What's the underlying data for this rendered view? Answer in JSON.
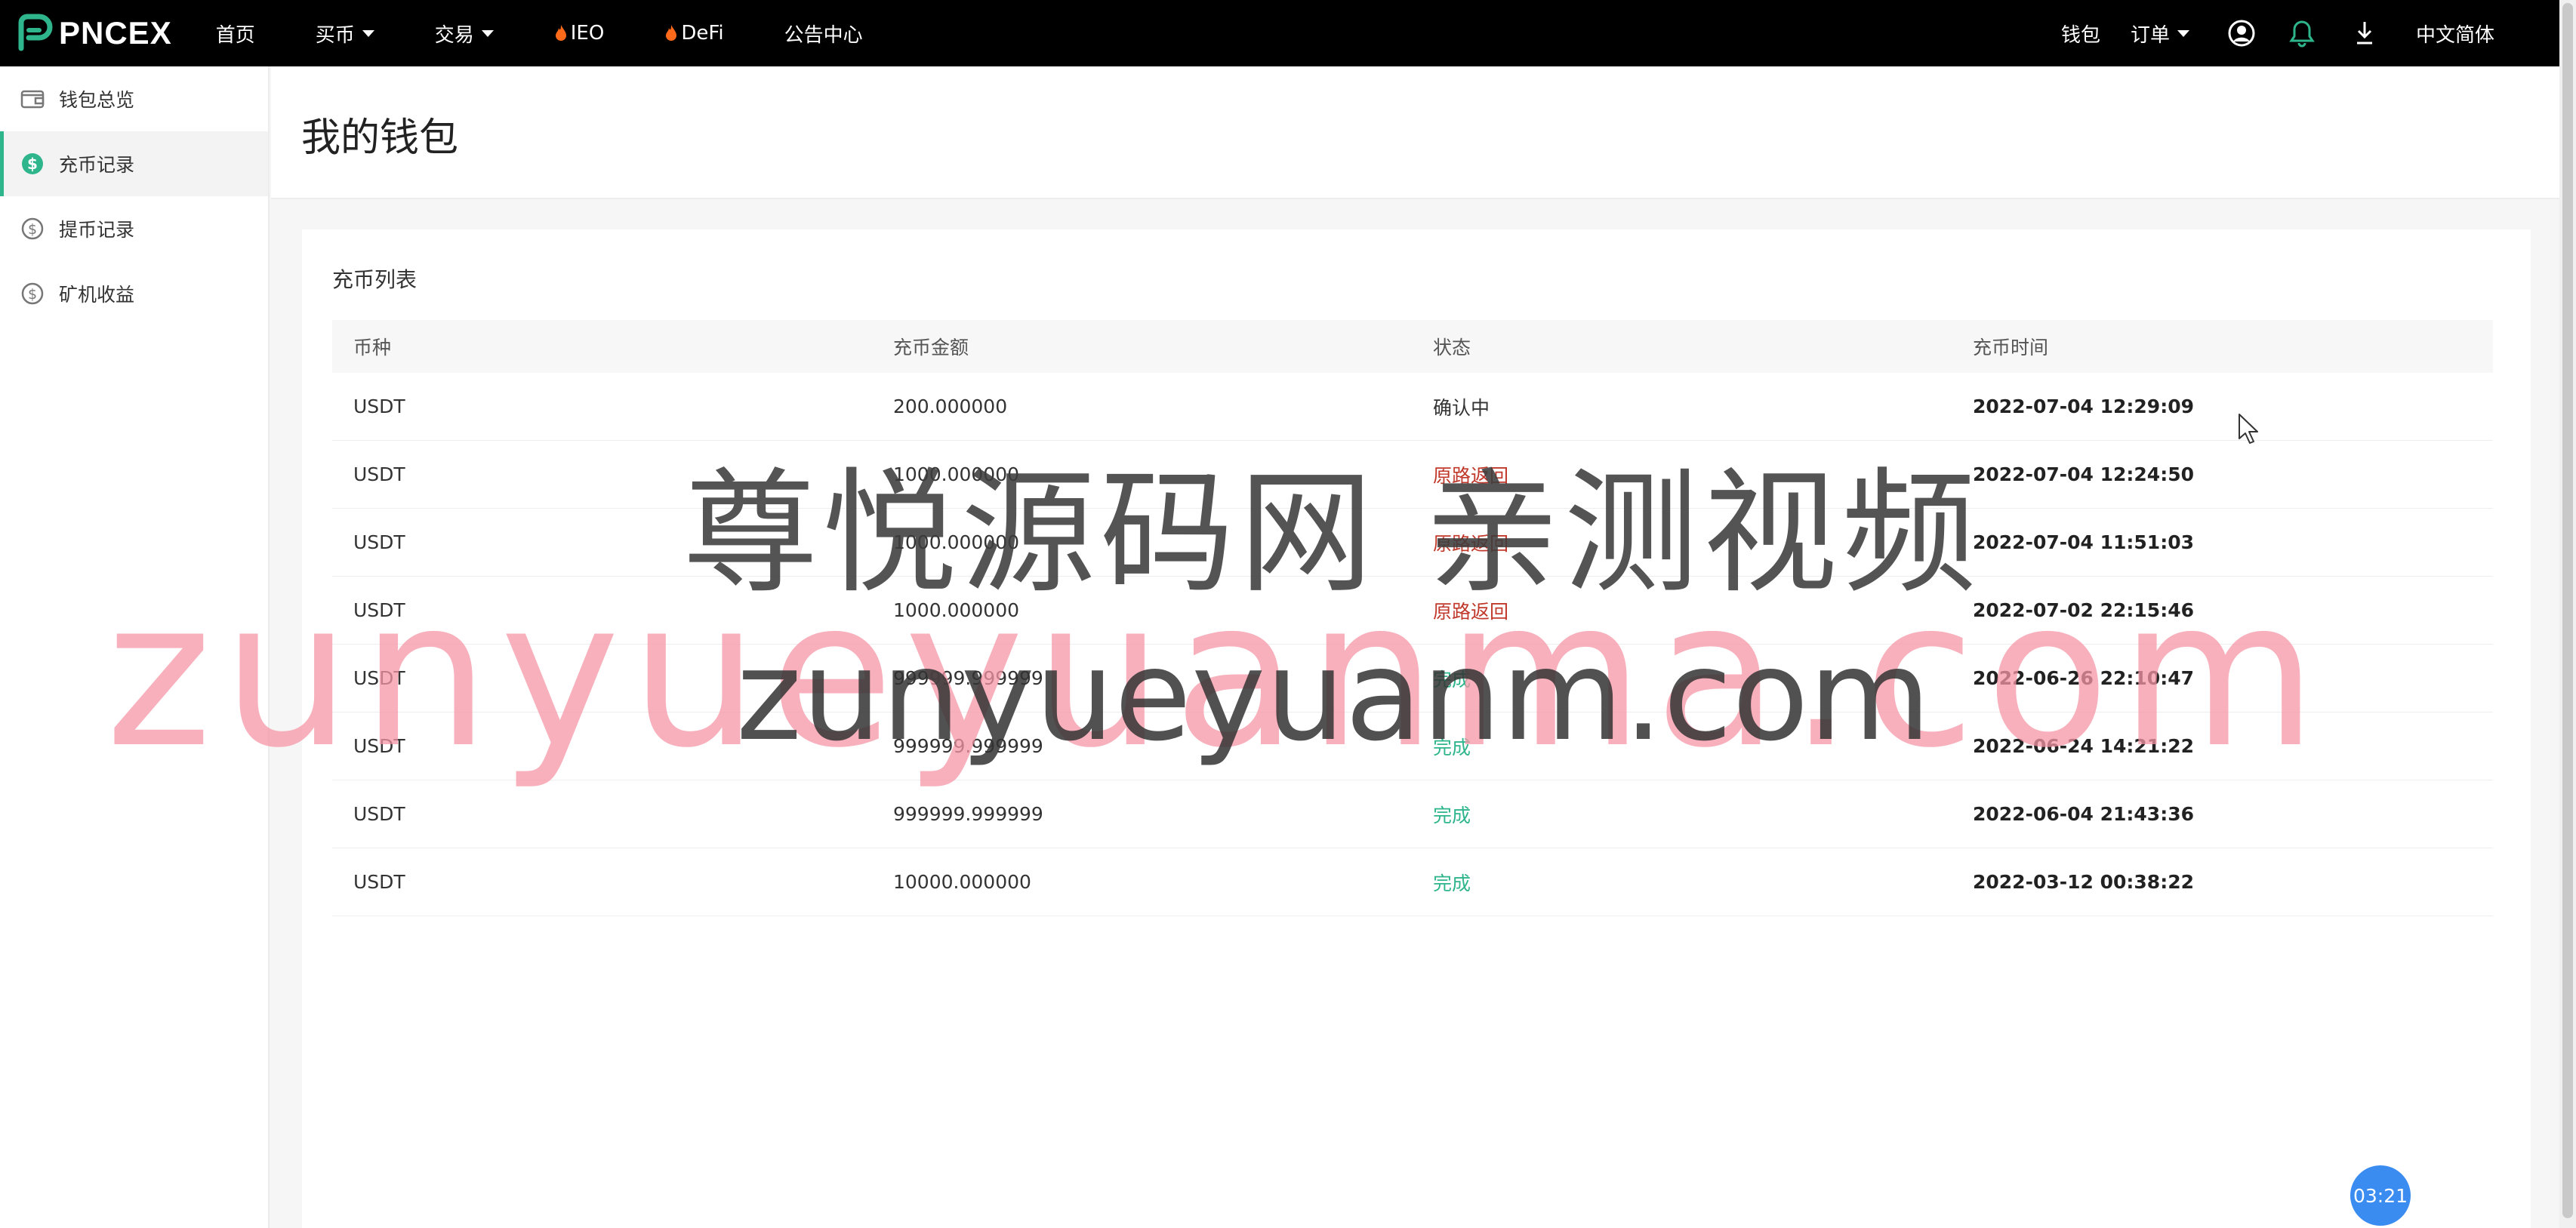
{
  "brand": {
    "name": "PNCEX",
    "accent": "#2eb58c"
  },
  "nav": {
    "home": "首页",
    "buy": "买币",
    "trade": "交易",
    "ieo": "IEO",
    "defi": "DeFi",
    "announcements": "公告中心",
    "wallet": "钱包",
    "orders": "订单",
    "language": "中文简体"
  },
  "sidebar": {
    "items": [
      {
        "label": "钱包总览",
        "icon": "wallet-icon"
      },
      {
        "label": "充币记录",
        "icon": "dollar-circle-icon",
        "active": true
      },
      {
        "label": "提币记录",
        "icon": "dollar-circle-icon"
      },
      {
        "label": "矿机收益",
        "icon": "dollar-circle-icon"
      }
    ]
  },
  "page": {
    "title": "我的钱包"
  },
  "deposit_list": {
    "title": "充币列表",
    "columns": [
      "币种",
      "充币金额",
      "状态",
      "充币时间"
    ],
    "rows": [
      {
        "coin": "USDT",
        "amount": "200.000000",
        "status": "确认中",
        "time": "2022-07-04 12:29:09"
      },
      {
        "coin": "USDT",
        "amount": "1000.000000",
        "status": "原路返回",
        "time": "2022-07-04 12:24:50"
      },
      {
        "coin": "USDT",
        "amount": "1000.000000",
        "status": "原路返回",
        "time": "2022-07-04 11:51:03"
      },
      {
        "coin": "USDT",
        "amount": "1000.000000",
        "status": "原路返回",
        "time": "2022-07-02 22:15:46"
      },
      {
        "coin": "USDT",
        "amount": "999999.999999",
        "status": "完成",
        "time": "2022-06-26 22:10:47"
      },
      {
        "coin": "USDT",
        "amount": "999999.999999",
        "status": "完成",
        "time": "2022-06-24 14:21:22"
      },
      {
        "coin": "USDT",
        "amount": "999999.999999",
        "status": "完成",
        "time": "2022-06-04 21:43:36"
      },
      {
        "coin": "USDT",
        "amount": "10000.000000",
        "status": "完成",
        "time": "2022-03-12 00:38:22"
      }
    ]
  },
  "watermarks": {
    "chinese": "尊悦源码网 亲测视频",
    "pink": "zunyueyuanma.com",
    "dark": "zunyueyuanm.com"
  },
  "timer": "03:21"
}
